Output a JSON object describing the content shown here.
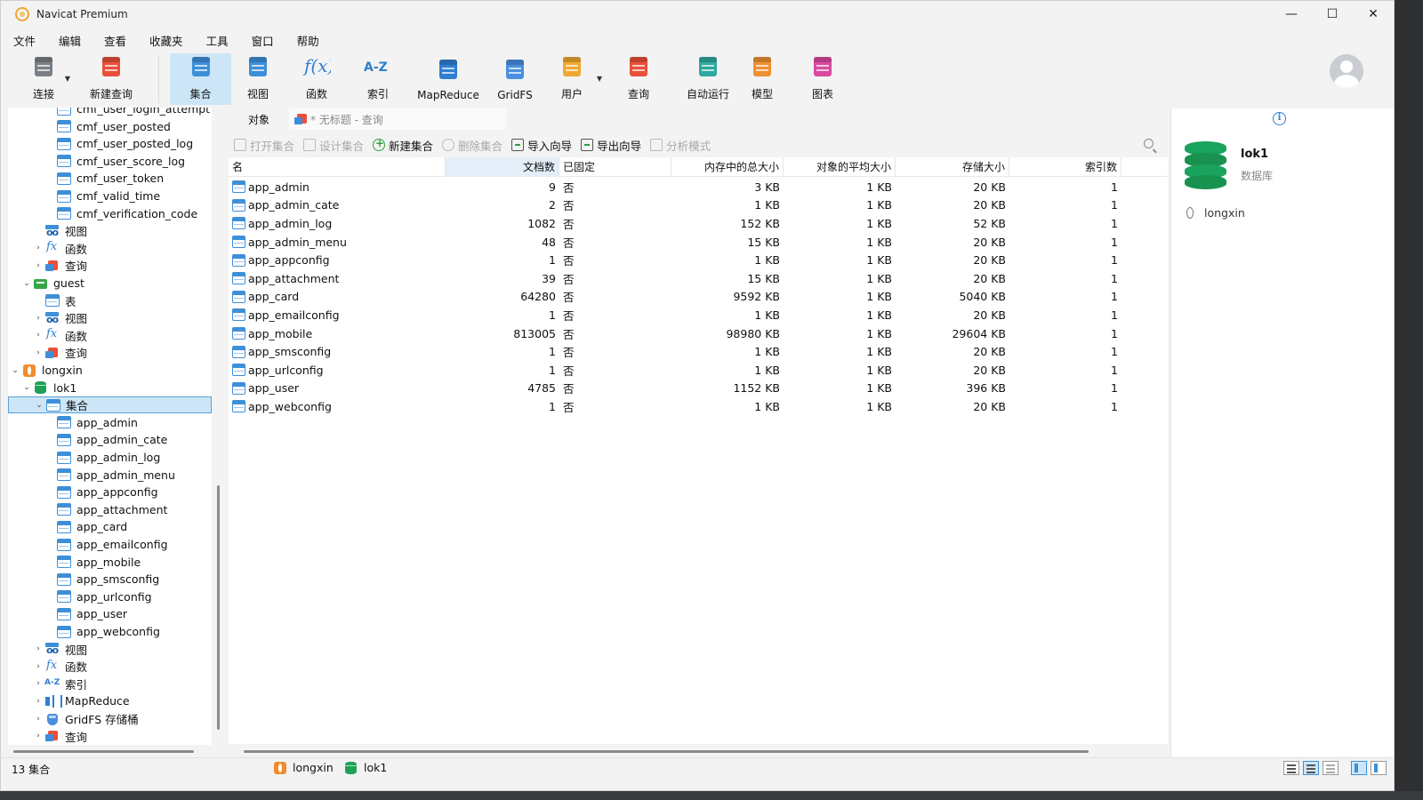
{
  "window": {
    "title": "Navicat Premium",
    "minimize": "—",
    "maximize": "☐",
    "close": "✕"
  },
  "menu": [
    "文件",
    "编辑",
    "查看",
    "收藏夹",
    "工具",
    "窗口",
    "帮助"
  ],
  "toolbar": [
    {
      "label": "连接",
      "icon": "plug-icon",
      "caret": true
    },
    {
      "label": "新建查询",
      "icon": "new-query-icon"
    },
    {
      "label": "集合",
      "icon": "collection-icon",
      "active": true
    },
    {
      "label": "视图",
      "icon": "view-icon"
    },
    {
      "label": "函数",
      "icon": "function-icon"
    },
    {
      "label": "索引",
      "icon": "index-icon"
    },
    {
      "label": "MapReduce",
      "icon": "mapreduce-icon"
    },
    {
      "label": "GridFS",
      "icon": "gridfs-icon"
    },
    {
      "label": "用户",
      "icon": "user-icon",
      "caret": true
    },
    {
      "label": "查询",
      "icon": "query-icon"
    },
    {
      "label": "自动运行",
      "icon": "robot-icon"
    },
    {
      "label": "模型",
      "icon": "model-icon"
    },
    {
      "label": "图表",
      "icon": "chart-icon"
    }
  ],
  "navigator": [
    {
      "label": "cmf_user_login_attempt",
      "indent": 3,
      "icon": "table",
      "arrow": ""
    },
    {
      "label": "cmf_user_posted",
      "indent": 3,
      "icon": "table",
      "arrow": ""
    },
    {
      "label": "cmf_user_posted_log",
      "indent": 3,
      "icon": "table",
      "arrow": ""
    },
    {
      "label": "cmf_user_score_log",
      "indent": 3,
      "icon": "table",
      "arrow": ""
    },
    {
      "label": "cmf_user_token",
      "indent": 3,
      "icon": "table",
      "arrow": ""
    },
    {
      "label": "cmf_valid_time",
      "indent": 3,
      "icon": "table",
      "arrow": ""
    },
    {
      "label": "cmf_verification_code",
      "indent": 3,
      "icon": "table",
      "arrow": ""
    },
    {
      "label": "视图",
      "indent": 2,
      "icon": "view",
      "arrow": ""
    },
    {
      "label": "函数",
      "indent": 2,
      "icon": "func",
      "arrow": "›"
    },
    {
      "label": "查询",
      "indent": 2,
      "icon": "query",
      "arrow": "›"
    },
    {
      "label": "guest",
      "indent": 1,
      "icon": "schema",
      "arrow": "⌄"
    },
    {
      "label": "表",
      "indent": 2,
      "icon": "table",
      "arrow": ""
    },
    {
      "label": "视图",
      "indent": 2,
      "icon": "view",
      "arrow": "›"
    },
    {
      "label": "函数",
      "indent": 2,
      "icon": "func",
      "arrow": "›"
    },
    {
      "label": "查询",
      "indent": 2,
      "icon": "query",
      "arrow": "›"
    },
    {
      "label": "longxin",
      "indent": 0,
      "icon": "mongo",
      "arrow": "⌄"
    },
    {
      "label": "lok1",
      "indent": 1,
      "icon": "db",
      "arrow": "⌄"
    },
    {
      "label": "集合",
      "indent": 2,
      "icon": "table",
      "arrow": "⌄",
      "selected": true
    },
    {
      "label": "app_admin",
      "indent": 3,
      "icon": "table",
      "arrow": ""
    },
    {
      "label": "app_admin_cate",
      "indent": 3,
      "icon": "table",
      "arrow": ""
    },
    {
      "label": "app_admin_log",
      "indent": 3,
      "icon": "table",
      "arrow": ""
    },
    {
      "label": "app_admin_menu",
      "indent": 3,
      "icon": "table",
      "arrow": ""
    },
    {
      "label": "app_appconfig",
      "indent": 3,
      "icon": "table",
      "arrow": ""
    },
    {
      "label": "app_attachment",
      "indent": 3,
      "icon": "table",
      "arrow": ""
    },
    {
      "label": "app_card",
      "indent": 3,
      "icon": "table",
      "arrow": ""
    },
    {
      "label": "app_emailconfig",
      "indent": 3,
      "icon": "table",
      "arrow": ""
    },
    {
      "label": "app_mobile",
      "indent": 3,
      "icon": "table",
      "arrow": ""
    },
    {
      "label": "app_smsconfig",
      "indent": 3,
      "icon": "table",
      "arrow": ""
    },
    {
      "label": "app_urlconfig",
      "indent": 3,
      "icon": "table",
      "arrow": ""
    },
    {
      "label": "app_user",
      "indent": 3,
      "icon": "table",
      "arrow": ""
    },
    {
      "label": "app_webconfig",
      "indent": 3,
      "icon": "table",
      "arrow": ""
    },
    {
      "label": "视图",
      "indent": 2,
      "icon": "view",
      "arrow": "›"
    },
    {
      "label": "函数",
      "indent": 2,
      "icon": "func",
      "arrow": "›"
    },
    {
      "label": "索引",
      "indent": 2,
      "icon": "index",
      "arrow": "›"
    },
    {
      "label": "MapReduce",
      "indent": 2,
      "icon": "mr",
      "arrow": "›"
    },
    {
      "label": "GridFS 存储桶",
      "indent": 2,
      "icon": "gridfs",
      "arrow": "›"
    },
    {
      "label": "查询",
      "indent": 2,
      "icon": "query",
      "arrow": "›"
    }
  ],
  "tabs": {
    "objects": "对象",
    "query": "* 无标题 - 查询"
  },
  "subtoolbar": [
    {
      "label": "打开集合",
      "enabled": false,
      "icon": "open-icon"
    },
    {
      "label": "设计集合",
      "enabled": false,
      "icon": "design-icon"
    },
    {
      "label": "新建集合",
      "enabled": true,
      "icon": "plus-icon"
    },
    {
      "label": "删除集合",
      "enabled": false,
      "icon": "minus-icon"
    },
    {
      "label": "导入向导",
      "enabled": true,
      "icon": "import-icon"
    },
    {
      "label": "导出向导",
      "enabled": true,
      "icon": "export-icon"
    },
    {
      "label": "分析模式",
      "enabled": false,
      "icon": "analyze-icon"
    }
  ],
  "grid": {
    "columns": [
      "名",
      "文档数",
      "已固定",
      "内存中的总大小",
      "对象的平均大小",
      "存储大小",
      "索引数"
    ],
    "rows": [
      [
        "app_admin",
        "9",
        "否",
        "3 KB",
        "1 KB",
        "20 KB",
        "1"
      ],
      [
        "app_admin_cate",
        "2",
        "否",
        "1 KB",
        "1 KB",
        "20 KB",
        "1"
      ],
      [
        "app_admin_log",
        "1082",
        "否",
        "152 KB",
        "1 KB",
        "52 KB",
        "1"
      ],
      [
        "app_admin_menu",
        "48",
        "否",
        "15 KB",
        "1 KB",
        "20 KB",
        "1"
      ],
      [
        "app_appconfig",
        "1",
        "否",
        "1 KB",
        "1 KB",
        "20 KB",
        "1"
      ],
      [
        "app_attachment",
        "39",
        "否",
        "15 KB",
        "1 KB",
        "20 KB",
        "1"
      ],
      [
        "app_card",
        "64280",
        "否",
        "9592 KB",
        "1 KB",
        "5040 KB",
        "1"
      ],
      [
        "app_emailconfig",
        "1",
        "否",
        "1 KB",
        "1 KB",
        "20 KB",
        "1"
      ],
      [
        "app_mobile",
        "813005",
        "否",
        "98980 KB",
        "1 KB",
        "29604 KB",
        "1"
      ],
      [
        "app_smsconfig",
        "1",
        "否",
        "1 KB",
        "1 KB",
        "20 KB",
        "1"
      ],
      [
        "app_urlconfig",
        "1",
        "否",
        "1 KB",
        "1 KB",
        "20 KB",
        "1"
      ],
      [
        "app_user",
        "4785",
        "否",
        "1152 KB",
        "1 KB",
        "396 KB",
        "1"
      ],
      [
        "app_webconfig",
        "1",
        "否",
        "1 KB",
        "1 KB",
        "20 KB",
        "1"
      ]
    ]
  },
  "info": {
    "name": "lok1",
    "type": "数据库",
    "connection": "longxin"
  },
  "status": {
    "count": "13 集合",
    "connection": "longxin",
    "database": "lok1"
  },
  "colors": {
    "accent": "#3d8fd8",
    "selection": "#cde6f7",
    "db_green": "#1aa35c"
  }
}
